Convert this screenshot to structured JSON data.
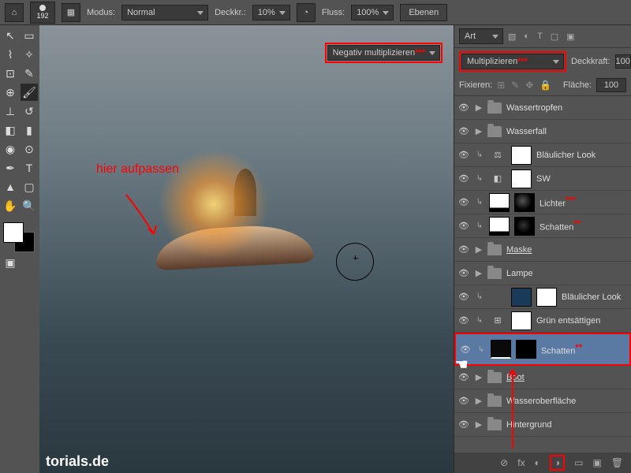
{
  "topbar": {
    "brush_size": "192",
    "modus_label": "Modus:",
    "modus_value": "Normal",
    "opacity_label": "Deckkr.:",
    "opacity_value": "10%",
    "flow_label": "Fluss:",
    "flow_value": "100%",
    "panel_tab": "Ebenen"
  },
  "canvas": {
    "annot_text": "hier aufpassen",
    "overlay_dd": "Negativ multiplizieren",
    "overlay_stars": "***",
    "watermark": "torials.de"
  },
  "panel": {
    "kind_value": "Art",
    "blend_mode": "Multiplizieren",
    "blend_stars": "***",
    "opacity_label": "Deckkraft:",
    "opacity_value": "100",
    "lock_label": "Fixieren:",
    "fill_label": "Fläche:",
    "fill_value": "100"
  },
  "layers": [
    {
      "type": "group",
      "name": "Wassertropfen"
    },
    {
      "type": "group",
      "name": "Wasserfall"
    },
    {
      "type": "adj",
      "icon": "⚖",
      "name": "Bläulicher Look",
      "clip": true
    },
    {
      "type": "adj",
      "icon": "◧",
      "name": "SW",
      "clip": true
    },
    {
      "type": "grad",
      "name": "Lichter",
      "stars": "***",
      "clip": true,
      "mask": "lichter"
    },
    {
      "type": "grad",
      "name": "Schatten",
      "stars": "**",
      "clip": true,
      "mask": "schatten-mask"
    },
    {
      "type": "group",
      "name": "Maske",
      "underlined": true
    },
    {
      "type": "group",
      "name": "Lampe"
    },
    {
      "type": "adj",
      "icon": "",
      "name": "Bläulicher Look",
      "clip": true,
      "thumb": "blue"
    },
    {
      "type": "adj",
      "icon": "⊞",
      "name": "Grün entsättigen",
      "clip": true
    },
    {
      "type": "grad",
      "name": "Schatten",
      "stars": "**",
      "clip": true,
      "selected": true,
      "thumb": "sel-schatten",
      "mask": "black"
    },
    {
      "type": "group",
      "name": "Boot",
      "underlined": true
    },
    {
      "type": "group",
      "name": "Wasseroberfläche"
    },
    {
      "type": "group",
      "name": "Hintergrund"
    }
  ],
  "footer_icons": [
    "⊘",
    "fx",
    "◐",
    "◑",
    "▭",
    "▣",
    "🗑"
  ]
}
